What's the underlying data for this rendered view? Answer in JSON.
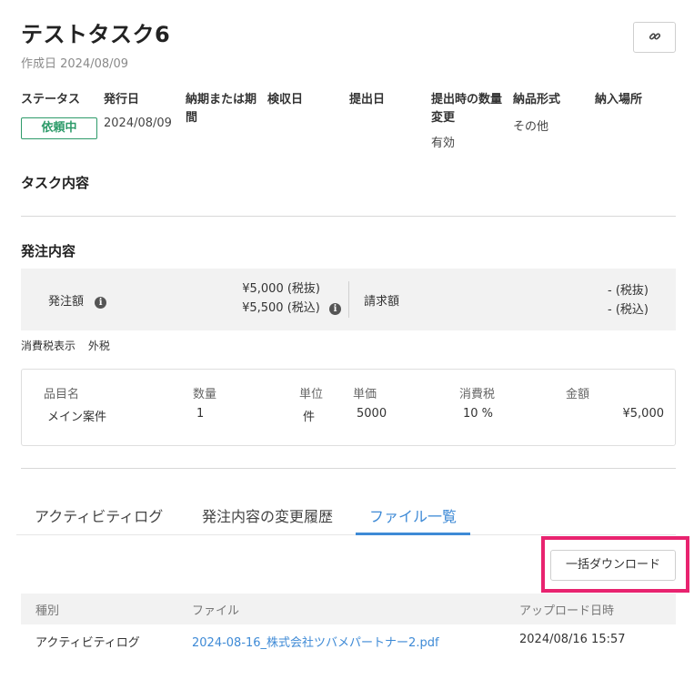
{
  "header": {
    "title": "テストタスク6",
    "created": "作成日 2024/08/09"
  },
  "meta": {
    "status_label": "ステータス",
    "status_value": "依頼中",
    "issue_date_label": "発行日",
    "issue_date_value": "2024/08/09",
    "deadline_label_1": "納期または期",
    "deadline_label_2": "間",
    "inspection_label": "検収日",
    "submission_label": "提出日",
    "qty_change_label_1": "提出時の数量",
    "qty_change_label_2": "変更",
    "qty_change_value": "有効",
    "delivery_format_label": "納品形式",
    "delivery_format_value": "その他",
    "delivery_place_label": "納入場所"
  },
  "sections": {
    "task_content": "タスク内容",
    "order_content": "発注内容"
  },
  "amounts": {
    "order_amount_label": "発注額",
    "order_amount_excl": "¥5,000 (税抜)",
    "order_amount_incl": "¥5,500 (税込)",
    "invoice_label": "請求額",
    "invoice_excl": "- (税抜)",
    "invoice_incl": "- (税込)"
  },
  "tax_display": {
    "label": "消費税表示",
    "value": "外税"
  },
  "items": {
    "headers": [
      "品目名",
      "数量",
      "単位",
      "単価",
      "消費税",
      "金額"
    ],
    "rows": [
      {
        "name": "メイン案件",
        "qty": "1",
        "unit": "件",
        "price": "5000",
        "tax": "10 %",
        "amount": "¥5,000"
      }
    ]
  },
  "tabs": [
    {
      "label": "アクティビティログ",
      "active": false
    },
    {
      "label": "発注内容の変更履歴",
      "active": false
    },
    {
      "label": "ファイル一覧",
      "active": true
    }
  ],
  "files": {
    "download_all": "一括ダウンロード",
    "headers": [
      "種別",
      "ファイル",
      "アップロード日時"
    ],
    "rows": [
      {
        "type": "アクティビティログ",
        "file": "2024-08-16_株式会社ツバメパートナー2.pdf",
        "uploaded": "2024/08/16 15:57"
      }
    ]
  },
  "colors": {
    "status_green": "#2e9b6a",
    "link_blue": "#3e8ad6",
    "highlight_pink": "#e8236f"
  }
}
